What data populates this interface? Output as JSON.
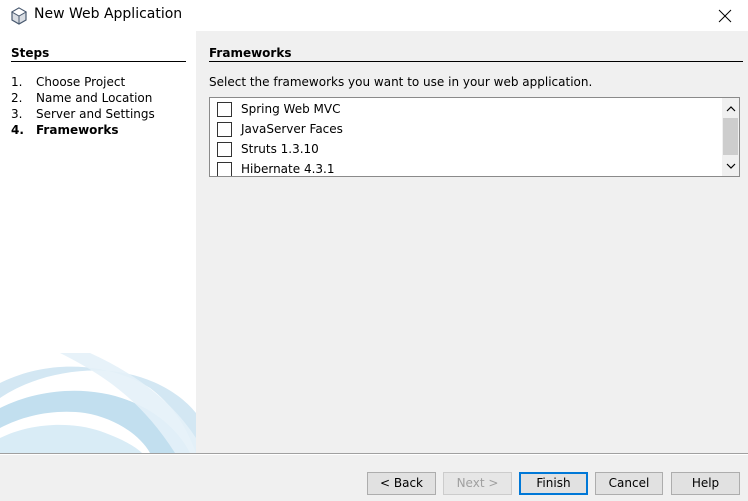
{
  "window": {
    "title": "New Web Application"
  },
  "steps": {
    "header": "Steps",
    "items": [
      {
        "num": "1.",
        "label": "Choose Project"
      },
      {
        "num": "2.",
        "label": "Name and Location"
      },
      {
        "num": "3.",
        "label": "Server and Settings"
      },
      {
        "num": "4.",
        "label": "Frameworks"
      }
    ],
    "active_index": 3
  },
  "content": {
    "header": "Frameworks",
    "instruction": "Select the frameworks you want to use in your web application.",
    "frameworks": [
      {
        "label": "Spring Web MVC",
        "checked": false
      },
      {
        "label": "JavaServer Faces",
        "checked": false
      },
      {
        "label": "Struts 1.3.10",
        "checked": false
      },
      {
        "label": "Hibernate 4.3.1",
        "checked": false
      }
    ]
  },
  "buttons": {
    "back": "< Back",
    "next": "Next >",
    "finish": "Finish",
    "cancel": "Cancel",
    "help": "Help"
  },
  "icons": {
    "app": "netbeans-cube-icon",
    "close": "close-icon",
    "scroll_up": "chevron-up-icon",
    "scroll_down": "chevron-down-icon"
  },
  "colors": {
    "focus_border": "#0078d7",
    "swoosh": "#bcdcee"
  }
}
